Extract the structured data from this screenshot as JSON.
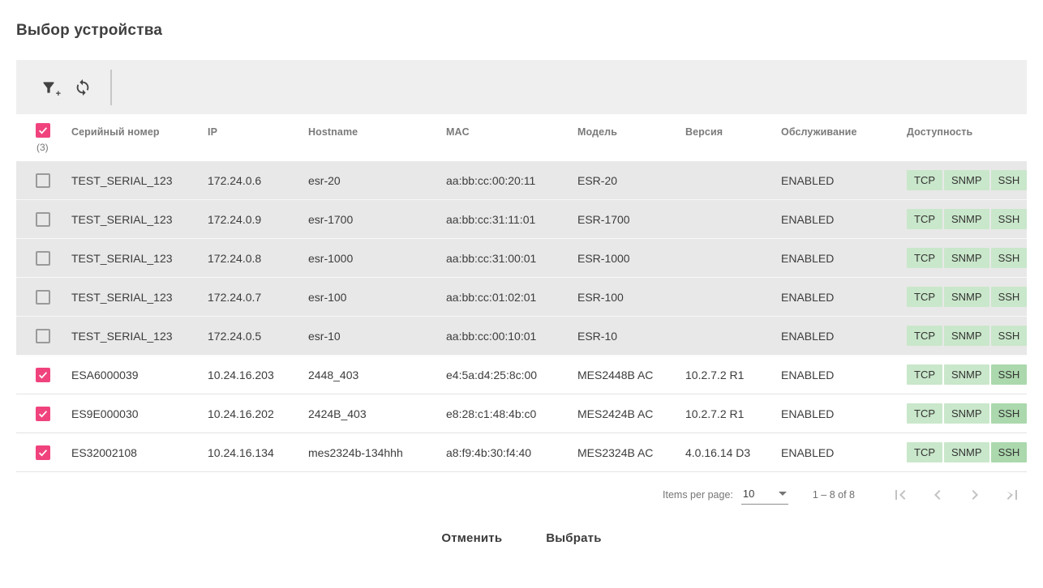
{
  "page": {
    "title": "Выбор устройства"
  },
  "toolbar": {
    "filter_icon": "filter-add-icon",
    "refresh_icon": "refresh-icon"
  },
  "table": {
    "select_all": {
      "checked": true,
      "count_label": "(3)"
    },
    "columns": [
      "Серийный номер",
      "IP",
      "Hostname",
      "MAC",
      "Модель",
      "Версия",
      "Обслуживание",
      "Доступность"
    ],
    "rows": [
      {
        "selected": false,
        "muted": true,
        "serial": "TEST_SERIAL_123",
        "ip": "172.24.0.6",
        "hostname": "esr-20",
        "mac": "aa:bb:cc:00:20:11",
        "model": "ESR-20",
        "version": "",
        "maintenance": "ENABLED",
        "availability": [
          {
            "label": "TCP",
            "tone": "light"
          },
          {
            "label": "SNMP",
            "tone": "light"
          },
          {
            "label": "SSH",
            "tone": "light"
          }
        ]
      },
      {
        "selected": false,
        "muted": true,
        "serial": "TEST_SERIAL_123",
        "ip": "172.24.0.9",
        "hostname": "esr-1700",
        "mac": "aa:bb:cc:31:11:01",
        "model": "ESR-1700",
        "version": "",
        "maintenance": "ENABLED",
        "availability": [
          {
            "label": "TCP",
            "tone": "light"
          },
          {
            "label": "SNMP",
            "tone": "light"
          },
          {
            "label": "SSH",
            "tone": "light"
          }
        ]
      },
      {
        "selected": false,
        "muted": true,
        "serial": "TEST_SERIAL_123",
        "ip": "172.24.0.8",
        "hostname": "esr-1000",
        "mac": "aa:bb:cc:31:00:01",
        "model": "ESR-1000",
        "version": "",
        "maintenance": "ENABLED",
        "availability": [
          {
            "label": "TCP",
            "tone": "light"
          },
          {
            "label": "SNMP",
            "tone": "light"
          },
          {
            "label": "SSH",
            "tone": "light"
          }
        ]
      },
      {
        "selected": false,
        "muted": true,
        "serial": "TEST_SERIAL_123",
        "ip": "172.24.0.7",
        "hostname": "esr-100",
        "mac": "aa:bb:cc:01:02:01",
        "model": "ESR-100",
        "version": "",
        "maintenance": "ENABLED",
        "availability": [
          {
            "label": "TCP",
            "tone": "light"
          },
          {
            "label": "SNMP",
            "tone": "light"
          },
          {
            "label": "SSH",
            "tone": "light"
          }
        ]
      },
      {
        "selected": false,
        "muted": true,
        "serial": "TEST_SERIAL_123",
        "ip": "172.24.0.5",
        "hostname": "esr-10",
        "mac": "aa:bb:cc:00:10:01",
        "model": "ESR-10",
        "version": "",
        "maintenance": "ENABLED",
        "availability": [
          {
            "label": "TCP",
            "tone": "light"
          },
          {
            "label": "SNMP",
            "tone": "light"
          },
          {
            "label": "SSH",
            "tone": "light"
          }
        ]
      },
      {
        "selected": true,
        "muted": false,
        "serial": "ESA6000039",
        "ip": "10.24.16.203",
        "hostname": "2448_403",
        "mac": "e4:5a:d4:25:8c:00",
        "model": "MES2448B AC",
        "version": "10.2.7.2 R1",
        "maintenance": "ENABLED",
        "availability": [
          {
            "label": "TCP",
            "tone": "light"
          },
          {
            "label": "SNMP",
            "tone": "light"
          },
          {
            "label": "SSH",
            "tone": "dark"
          }
        ]
      },
      {
        "selected": true,
        "muted": false,
        "serial": "ES9E000030",
        "ip": "10.24.16.202",
        "hostname": "2424B_403",
        "mac": "e8:28:c1:48:4b:c0",
        "model": "MES2424B AC",
        "version": "10.2.7.2 R1",
        "maintenance": "ENABLED",
        "availability": [
          {
            "label": "TCP",
            "tone": "light"
          },
          {
            "label": "SNMP",
            "tone": "light"
          },
          {
            "label": "SSH",
            "tone": "dark"
          }
        ]
      },
      {
        "selected": true,
        "muted": false,
        "serial": "ES32002108",
        "ip": "10.24.16.134",
        "hostname": "mes2324b-134hhh",
        "mac": "a8:f9:4b:30:f4:40",
        "model": "MES2324B AC",
        "version": "4.0.16.14 D3",
        "maintenance": "ENABLED",
        "availability": [
          {
            "label": "TCP",
            "tone": "light"
          },
          {
            "label": "SNMP",
            "tone": "light"
          },
          {
            "label": "SSH",
            "tone": "dark"
          }
        ]
      }
    ]
  },
  "paginator": {
    "items_per_page_label": "Items per page:",
    "page_size": "10",
    "range_label": "1 – 8 of 8"
  },
  "actions": {
    "cancel_label": "Отменить",
    "select_label": "Выбрать"
  },
  "colors": {
    "accent_pink": "#f0437e",
    "chip_green_light": "#c9e7ca",
    "chip_green_dark": "#abd8ad"
  }
}
